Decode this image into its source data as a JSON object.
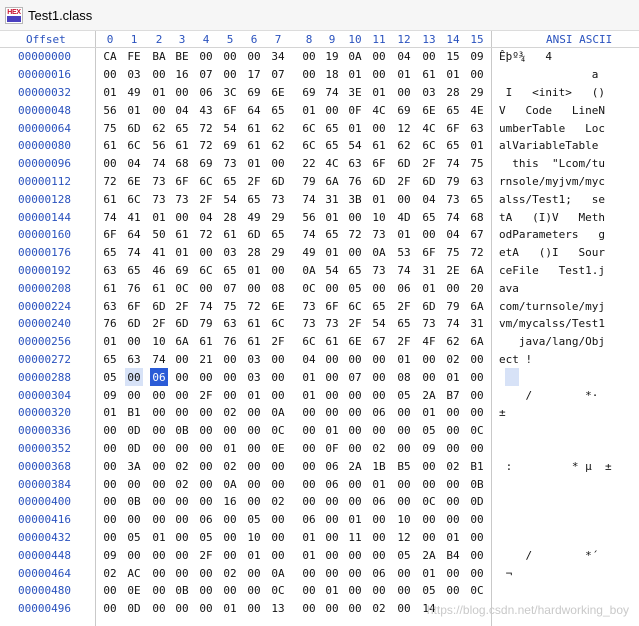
{
  "window": {
    "title": "Test1.class",
    "icon": "hex-editor-icon"
  },
  "header": {
    "offset_label": "Offset",
    "columns": [
      "0",
      "1",
      "2",
      "3",
      "4",
      "5",
      "6",
      "7",
      "8",
      "9",
      "10",
      "11",
      "12",
      "13",
      "14",
      "15"
    ],
    "ascii_label": "ANSI ASCII"
  },
  "rows": [
    {
      "offset": "00000000",
      "bytes": [
        "CA",
        "FE",
        "BA",
        "BE",
        "00",
        "00",
        "00",
        "34",
        "00",
        "19",
        "0A",
        "00",
        "04",
        "00",
        "15",
        "09"
      ],
      "ascii": "Êþº¾   4"
    },
    {
      "offset": "00000016",
      "bytes": [
        "00",
        "03",
        "00",
        "16",
        "07",
        "00",
        "17",
        "07",
        "00",
        "18",
        "01",
        "00",
        "01",
        "61",
        "01",
        "00"
      ],
      "ascii": "              a"
    },
    {
      "offset": "00000032",
      "bytes": [
        "01",
        "49",
        "01",
        "00",
        "06",
        "3C",
        "69",
        "6E",
        "69",
        "74",
        "3E",
        "01",
        "00",
        "03",
        "28",
        "29"
      ],
      "ascii": " I   <init>   ()"
    },
    {
      "offset": "00000048",
      "bytes": [
        "56",
        "01",
        "00",
        "04",
        "43",
        "6F",
        "64",
        "65",
        "01",
        "00",
        "0F",
        "4C",
        "69",
        "6E",
        "65",
        "4E"
      ],
      "ascii": "V   Code   LineN"
    },
    {
      "offset": "00000064",
      "bytes": [
        "75",
        "6D",
        "62",
        "65",
        "72",
        "54",
        "61",
        "62",
        "6C",
        "65",
        "01",
        "00",
        "12",
        "4C",
        "6F",
        "63"
      ],
      "ascii": "umberTable   Loc"
    },
    {
      "offset": "00000080",
      "bytes": [
        "61",
        "6C",
        "56",
        "61",
        "72",
        "69",
        "61",
        "62",
        "6C",
        "65",
        "54",
        "61",
        "62",
        "6C",
        "65",
        "01"
      ],
      "ascii": "alVariableTable"
    },
    {
      "offset": "00000096",
      "bytes": [
        "00",
        "04",
        "74",
        "68",
        "69",
        "73",
        "01",
        "00",
        "22",
        "4C",
        "63",
        "6F",
        "6D",
        "2F",
        "74",
        "75"
      ],
      "ascii": "  this  \"Lcom/tu"
    },
    {
      "offset": "00000112",
      "bytes": [
        "72",
        "6E",
        "73",
        "6F",
        "6C",
        "65",
        "2F",
        "6D",
        "79",
        "6A",
        "76",
        "6D",
        "2F",
        "6D",
        "79",
        "63"
      ],
      "ascii": "rnsole/myjvm/myc"
    },
    {
      "offset": "00000128",
      "bytes": [
        "61",
        "6C",
        "73",
        "73",
        "2F",
        "54",
        "65",
        "73",
        "74",
        "31",
        "3B",
        "01",
        "00",
        "04",
        "73",
        "65"
      ],
      "ascii": "alss/Test1;   se"
    },
    {
      "offset": "00000144",
      "bytes": [
        "74",
        "41",
        "01",
        "00",
        "04",
        "28",
        "49",
        "29",
        "56",
        "01",
        "00",
        "10",
        "4D",
        "65",
        "74",
        "68"
      ],
      "ascii": "tA   (I)V   Meth"
    },
    {
      "offset": "00000160",
      "bytes": [
        "6F",
        "64",
        "50",
        "61",
        "72",
        "61",
        "6D",
        "65",
        "74",
        "65",
        "72",
        "73",
        "01",
        "00",
        "04",
        "67"
      ],
      "ascii": "odParameters   g"
    },
    {
      "offset": "00000176",
      "bytes": [
        "65",
        "74",
        "41",
        "01",
        "00",
        "03",
        "28",
        "29",
        "49",
        "01",
        "00",
        "0A",
        "53",
        "6F",
        "75",
        "72"
      ],
      "ascii": "etA   ()I   Sour"
    },
    {
      "offset": "00000192",
      "bytes": [
        "63",
        "65",
        "46",
        "69",
        "6C",
        "65",
        "01",
        "00",
        "0A",
        "54",
        "65",
        "73",
        "74",
        "31",
        "2E",
        "6A"
      ],
      "ascii": "ceFile   Test1.j"
    },
    {
      "offset": "00000208",
      "bytes": [
        "61",
        "76",
        "61",
        "0C",
        "00",
        "07",
        "00",
        "08",
        "0C",
        "00",
        "05",
        "00",
        "06",
        "01",
        "00",
        "20"
      ],
      "ascii": "ava"
    },
    {
      "offset": "00000224",
      "bytes": [
        "63",
        "6F",
        "6D",
        "2F",
        "74",
        "75",
        "72",
        "6E",
        "73",
        "6F",
        "6C",
        "65",
        "2F",
        "6D",
        "79",
        "6A"
      ],
      "ascii": "com/turnsole/myj"
    },
    {
      "offset": "00000240",
      "bytes": [
        "76",
        "6D",
        "2F",
        "6D",
        "79",
        "63",
        "61",
        "6C",
        "73",
        "73",
        "2F",
        "54",
        "65",
        "73",
        "74",
        "31"
      ],
      "ascii": "vm/mycalss/Test1"
    },
    {
      "offset": "00000256",
      "bytes": [
        "01",
        "00",
        "10",
        "6A",
        "61",
        "76",
        "61",
        "2F",
        "6C",
        "61",
        "6E",
        "67",
        "2F",
        "4F",
        "62",
        "6A"
      ],
      "ascii": "   java/lang/Obj"
    },
    {
      "offset": "00000272",
      "bytes": [
        "65",
        "63",
        "74",
        "00",
        "21",
        "00",
        "03",
        "00",
        "04",
        "00",
        "00",
        "00",
        "01",
        "00",
        "02",
        "00"
      ],
      "ascii": "ect !"
    },
    {
      "offset": "00000288",
      "bytes": [
        "05",
        "00",
        "06",
        "00",
        "00",
        "00",
        "03",
        "00",
        "01",
        "00",
        "07",
        "00",
        "08",
        "00",
        "01",
        "00"
      ],
      "ascii": ""
    },
    {
      "offset": "00000304",
      "bytes": [
        "09",
        "00",
        "00",
        "00",
        "2F",
        "00",
        "01",
        "00",
        "01",
        "00",
        "00",
        "00",
        "05",
        "2A",
        "B7",
        "00"
      ],
      "ascii": "    /        *·"
    },
    {
      "offset": "00000320",
      "bytes": [
        "01",
        "B1",
        "00",
        "00",
        "00",
        "02",
        "00",
        "0A",
        "00",
        "00",
        "00",
        "06",
        "00",
        "01",
        "00",
        "00"
      ],
      "ascii": "±"
    },
    {
      "offset": "00000336",
      "bytes": [
        "00",
        "0D",
        "00",
        "0B",
        "00",
        "00",
        "00",
        "0C",
        "00",
        "01",
        "00",
        "00",
        "00",
        "05",
        "00",
        "0C"
      ],
      "ascii": ""
    },
    {
      "offset": "00000352",
      "bytes": [
        "00",
        "0D",
        "00",
        "00",
        "00",
        "01",
        "00",
        "0E",
        "00",
        "0F",
        "00",
        "02",
        "00",
        "09",
        "00",
        "00"
      ],
      "ascii": ""
    },
    {
      "offset": "00000368",
      "bytes": [
        "00",
        "3A",
        "00",
        "02",
        "00",
        "02",
        "00",
        "00",
        "00",
        "06",
        "2A",
        "1B",
        "B5",
        "00",
        "02",
        "B1"
      ],
      "ascii": " :         * µ  ±"
    },
    {
      "offset": "00000384",
      "bytes": [
        "00",
        "00",
        "00",
        "02",
        "00",
        "0A",
        "00",
        "00",
        "00",
        "06",
        "00",
        "01",
        "00",
        "00",
        "00",
        "0B"
      ],
      "ascii": ""
    },
    {
      "offset": "00000400",
      "bytes": [
        "00",
        "0B",
        "00",
        "00",
        "00",
        "16",
        "00",
        "02",
        "00",
        "00",
        "00",
        "06",
        "00",
        "0C",
        "00",
        "0D"
      ],
      "ascii": ""
    },
    {
      "offset": "00000416",
      "bytes": [
        "00",
        "00",
        "00",
        "00",
        "06",
        "00",
        "05",
        "00",
        "06",
        "00",
        "01",
        "00",
        "10",
        "00",
        "00",
        "00"
      ],
      "ascii": ""
    },
    {
      "offset": "00000432",
      "bytes": [
        "00",
        "05",
        "01",
        "00",
        "05",
        "00",
        "10",
        "00",
        "01",
        "00",
        "11",
        "00",
        "12",
        "00",
        "01",
        "00"
      ],
      "ascii": ""
    },
    {
      "offset": "00000448",
      "bytes": [
        "09",
        "00",
        "00",
        "00",
        "2F",
        "00",
        "01",
        "00",
        "01",
        "00",
        "00",
        "00",
        "05",
        "2A",
        "B4",
        "00"
      ],
      "ascii": "    /        *´"
    },
    {
      "offset": "00000464",
      "bytes": [
        "02",
        "AC",
        "00",
        "00",
        "00",
        "02",
        "00",
        "0A",
        "00",
        "00",
        "00",
        "06",
        "00",
        "01",
        "00",
        "00"
      ],
      "ascii": " ¬"
    },
    {
      "offset": "00000480",
      "bytes": [
        "00",
        "0E",
        "00",
        "0B",
        "00",
        "00",
        "00",
        "0C",
        "00",
        "01",
        "00",
        "00",
        "00",
        "05",
        "00",
        "0C"
      ],
      "ascii": ""
    },
    {
      "offset": "00000496",
      "bytes": [
        "00",
        "0D",
        "00",
        "00",
        "00",
        "01",
        "00",
        "13",
        "00",
        "00",
        "00",
        "02",
        "00",
        "14"
      ],
      "ascii": ""
    }
  ],
  "watermark": "https://blog.csdn.net/hardworking_boy",
  "colors": {
    "offset": "#2a52be",
    "selection": "#2a5bd7",
    "selection_light": "#d7e2f7"
  }
}
